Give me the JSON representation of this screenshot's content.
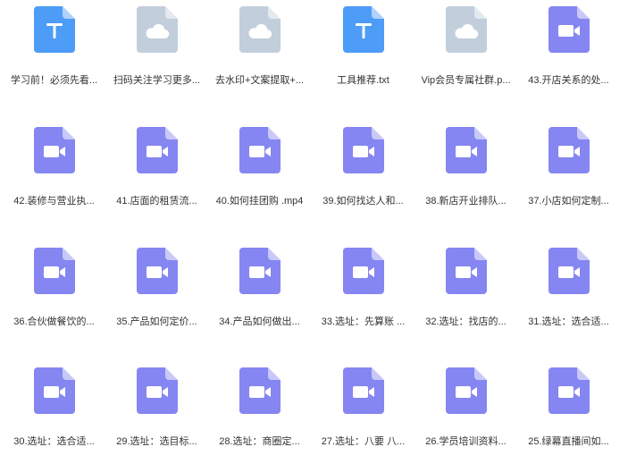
{
  "colors": {
    "video": "#8586f2",
    "text_doc": "#4d9cf8",
    "cloud": "#c2cedb"
  },
  "files": [
    {
      "name": "学习前！必须先看...",
      "icon": "text-file-icon"
    },
    {
      "name": "扫码关注学习更多...",
      "icon": "cloud-file-icon"
    },
    {
      "name": "去水印+文案提取+...",
      "icon": "cloud-file-icon"
    },
    {
      "name": "工具推荐.txt",
      "icon": "text-file-icon"
    },
    {
      "name": "Vip会员专属社群.p...",
      "icon": "cloud-file-icon"
    },
    {
      "name": "43.开店关系的处...",
      "icon": "video-file-icon"
    },
    {
      "name": "42.装修与营业执...",
      "icon": "video-file-icon"
    },
    {
      "name": "41.店面的租赁流...",
      "icon": "video-file-icon"
    },
    {
      "name": "40.如何挂团购 .mp4",
      "icon": "video-file-icon"
    },
    {
      "name": "39.如何找达人和...",
      "icon": "video-file-icon"
    },
    {
      "name": "38.新店开业排队...",
      "icon": "video-file-icon"
    },
    {
      "name": "37.小店如何定制...",
      "icon": "video-file-icon"
    },
    {
      "name": "36.合伙做餐饮的...",
      "icon": "video-file-icon"
    },
    {
      "name": "35.产品如何定价...",
      "icon": "video-file-icon"
    },
    {
      "name": "34.产品如何做出...",
      "icon": "video-file-icon"
    },
    {
      "name": "33.选址：先算账 ...",
      "icon": "video-file-icon"
    },
    {
      "name": "32.选址：找店的...",
      "icon": "video-file-icon"
    },
    {
      "name": "31.选址：选合适...",
      "icon": "video-file-icon"
    },
    {
      "name": "30.选址：选合适...",
      "icon": "video-file-icon"
    },
    {
      "name": "29.选址：选目标...",
      "icon": "video-file-icon"
    },
    {
      "name": "28.选址：商圈定...",
      "icon": "video-file-icon"
    },
    {
      "name": "27.选址：八要 八...",
      "icon": "video-file-icon"
    },
    {
      "name": "26.学员培训资料...",
      "icon": "video-file-icon"
    },
    {
      "name": "25.绿幕直播间如...",
      "icon": "video-file-icon"
    }
  ]
}
